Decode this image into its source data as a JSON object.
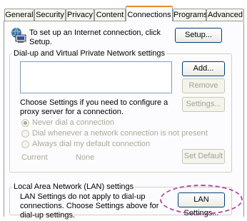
{
  "tabs": [
    {
      "label": "General"
    },
    {
      "label": "Security"
    },
    {
      "label": "Privacy"
    },
    {
      "label": "Content"
    },
    {
      "label": "Connections"
    },
    {
      "label": "Programs"
    },
    {
      "label": "Advanced"
    }
  ],
  "active_tab": "Connections",
  "setup": {
    "text": "To set up an Internet connection, click Setup.",
    "button": "Setup..."
  },
  "dialup": {
    "group_label": "Dial-up and Virtual Private Network settings",
    "add_button": "Add...",
    "remove_button": "Remove",
    "settings_text": "Choose Settings if you need to configure a proxy server for a connection.",
    "settings_button": "Settings...",
    "radios": [
      {
        "label": "Never dial a connection",
        "selected": true
      },
      {
        "label": "Dial whenever a network connection is not present",
        "selected": false
      },
      {
        "label": "Always dial my default connection",
        "selected": false
      }
    ],
    "current_label": "Current",
    "current_value": "None",
    "set_default_button": "Set Default"
  },
  "lan": {
    "group_label": "Local Area Network (LAN) settings",
    "text": "LAN Settings do not apply to dial-up connections. Choose Settings above for dial-up settings.",
    "button": "LAN Settings..."
  },
  "colors": {
    "active_tab_accent": "#e68b2c",
    "highlight": "#b44da8"
  }
}
